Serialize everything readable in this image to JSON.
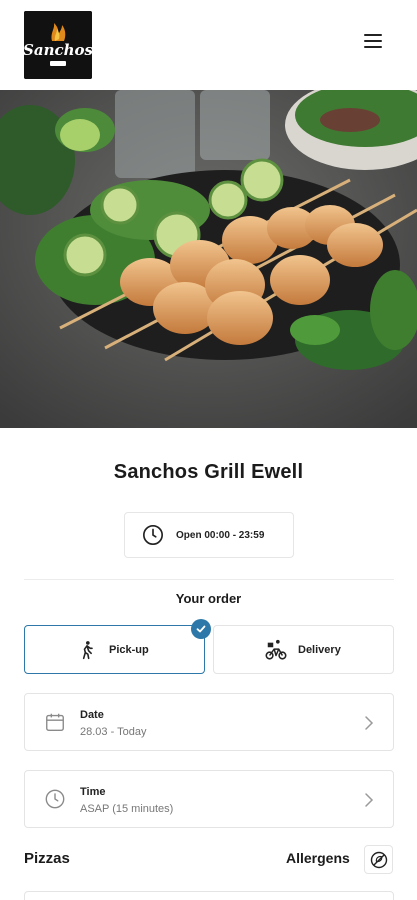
{
  "brand": {
    "logo_text": "Sanchos",
    "logo_subtext": "GRILL"
  },
  "header": {
    "menu_icon": "hamburger-menu-icon"
  },
  "hero": {
    "description_icon": "chicken-skewers-photo"
  },
  "restaurant": {
    "name": "Sanchos Grill Ewell",
    "hours": "Open 00:00 - 23:59"
  },
  "order": {
    "heading": "Your order",
    "modes": [
      {
        "label": "Pick-up",
        "icon": "walking-person-icon",
        "selected": true
      },
      {
        "label": "Delivery",
        "icon": "bicycle-courier-icon",
        "selected": false
      }
    ],
    "date": {
      "title": "Date",
      "value": "28.03 - Today",
      "icon": "calendar-icon"
    },
    "time": {
      "title": "Time",
      "value": "ASAP (15 minutes)",
      "icon": "clock-icon"
    }
  },
  "menu_section": {
    "title": "Pizzas",
    "allergens_label": "Allergens",
    "allergens_icon": "no-allergen-icon"
  },
  "colors": {
    "accent": "#2d78a8",
    "text": "#1b1b1b",
    "muted": "#777777",
    "border": "#e4e4e4"
  }
}
